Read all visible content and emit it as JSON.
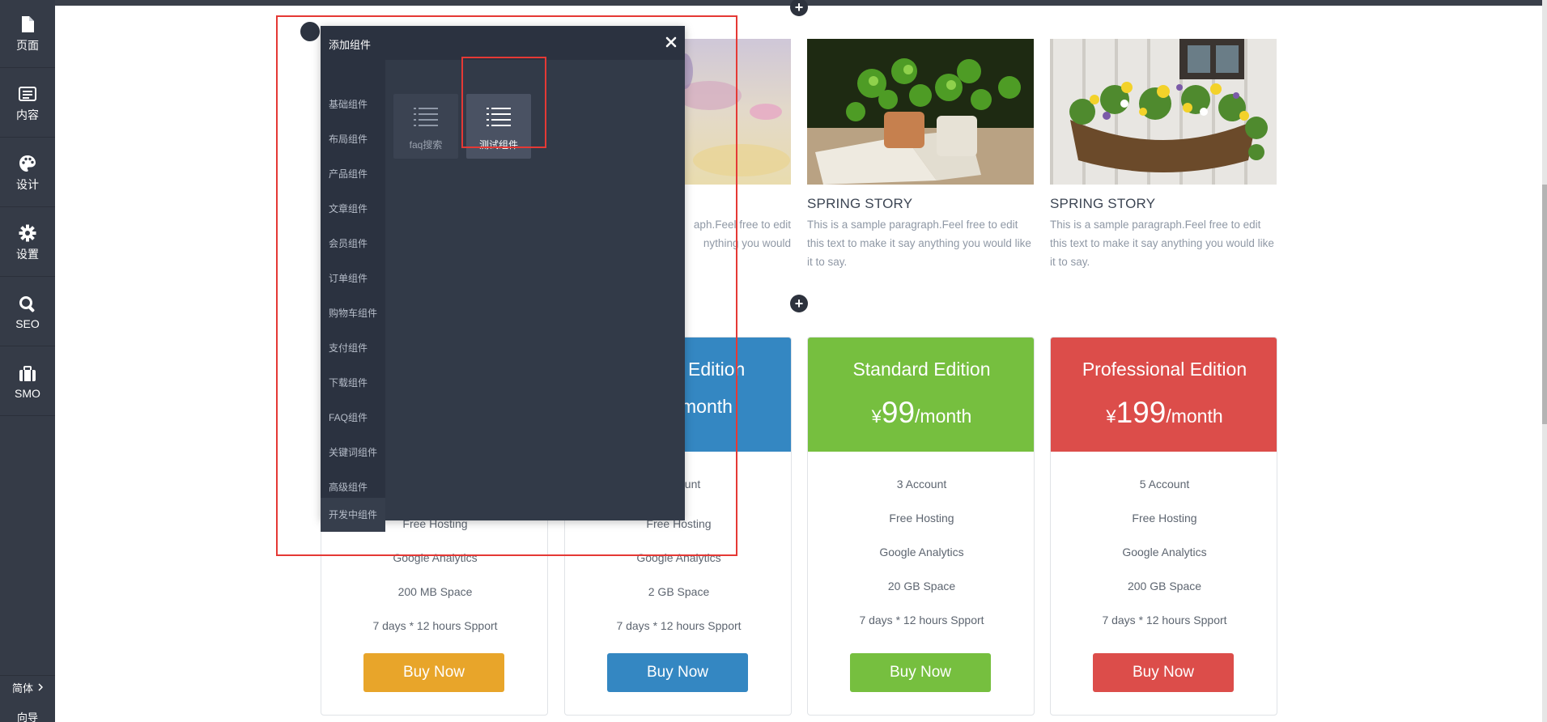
{
  "sidebar": {
    "items": [
      {
        "label": "页面",
        "icon": "page-icon"
      },
      {
        "label": "内容",
        "icon": "content-icon"
      },
      {
        "label": "设计",
        "icon": "palette-icon"
      },
      {
        "label": "设置",
        "icon": "gear-icon"
      },
      {
        "label": "SEO",
        "icon": "search-icon"
      },
      {
        "label": "SMO",
        "icon": "briefcase-icon"
      }
    ],
    "language": "简体",
    "guide": "向导"
  },
  "blog": {
    "cards": [
      {
        "title": "",
        "text": "This is a sample paragraph.Feel free to edit this text to make it say anything you would like it to say.",
        "visible_text": "aph.Feel free to edit\nnything you would"
      },
      {
        "title": "SPRING STORY",
        "text": "This is a sample paragraph.Feel free to edit this text to make it say anything you would like it to say."
      },
      {
        "title": "SPRING STORY",
        "text": "This is a sample paragraph.Feel free to edit this text to make it say anything you would like it to say."
      }
    ]
  },
  "pricing": {
    "plans": [
      {
        "name": "",
        "currency": "",
        "amount": "",
        "period": "",
        "features": [
          "",
          "Free Hosting",
          "Google Analytics",
          "200 MB Space",
          "7 days * 12 hours Spport"
        ],
        "button": "Buy Now",
        "color": "#e8a52a"
      },
      {
        "name": "Edition",
        "currency": "",
        "amount": "",
        "period": "month",
        "features": [
          "ount",
          "Free Hosting",
          "Google Analytics",
          "2 GB Space",
          "7 days * 12 hours Spport"
        ],
        "button": "Buy Now",
        "color": "#3487c2"
      },
      {
        "name": "Standard Edition",
        "currency": "¥",
        "amount": "99",
        "period": "/month",
        "features": [
          "3 Account",
          "Free Hosting",
          "Google Analytics",
          "20 GB Space",
          "7 days * 12 hours Spport"
        ],
        "button": "Buy Now",
        "color": "#76bf3f"
      },
      {
        "name": "Professional Edition",
        "currency": "¥",
        "amount": "199",
        "period": "/month",
        "features": [
          "5 Account",
          "Free Hosting",
          "Google Analytics",
          "200 GB Space",
          "7 days * 12 hours Spport"
        ],
        "button": "Buy Now",
        "color": "#dc4d4a"
      }
    ]
  },
  "dialog": {
    "title": "添加组件",
    "close_icon": "close-icon",
    "categories": [
      "基础组件",
      "布局组件",
      "产品组件",
      "文章组件",
      "会员组件",
      "订单组件",
      "购物车组件",
      "支付组件",
      "下载组件",
      "FAQ组件",
      "关键词组件",
      "高级组件",
      "开发中组件"
    ],
    "components": [
      {
        "label": "faq搜索",
        "icon": "list-icon"
      },
      {
        "label": "测试组件",
        "icon": "list-icon",
        "selected": true
      }
    ]
  },
  "colors": {
    "sidebar_bg": "#353b47",
    "dialog_bg": "#323a48",
    "highlight": "#e53935"
  }
}
